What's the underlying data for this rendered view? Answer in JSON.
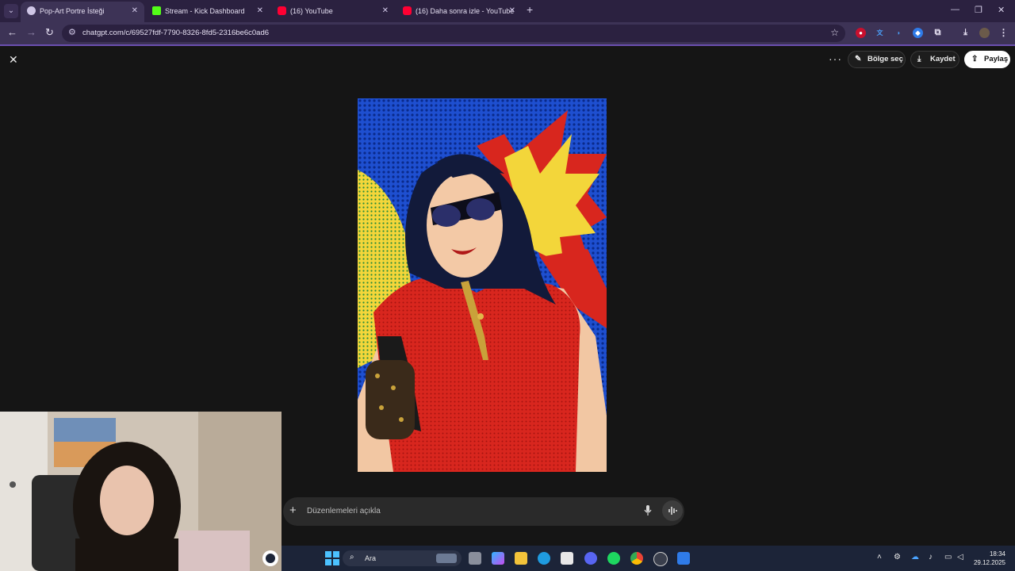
{
  "tabs": [
    {
      "title": "Pop-Art Portre İsteği",
      "active": true,
      "favicon": "chatgpt-icon"
    },
    {
      "title": "Stream - Kick Dashboard",
      "active": false,
      "favicon": "kick-icon"
    },
    {
      "title": "(16) YouTube",
      "active": false,
      "favicon": "youtube-icon"
    },
    {
      "title": "(16) Daha sonra izle - YouTube",
      "active": false,
      "favicon": "youtube-icon"
    }
  ],
  "address_bar": {
    "url": "chatgpt.com/c/69527fdf-7790-8326-8fd5-2316be6c0ad6"
  },
  "viewer": {
    "select_region_label": "Bölge seç",
    "save_label": "Kaydet",
    "share_label": "Paylaş"
  },
  "prompt": {
    "placeholder": "Düzenlemeleri açıkla"
  },
  "taskbar": {
    "search_label": "Ara",
    "time": "18:34",
    "date": "29.12.2025"
  },
  "colors": {
    "tab_strip": "#2b2140",
    "toolbar": "#3d3356",
    "page_bg": "#151515",
    "taskbar": "#1c2438",
    "art_blue": "#1e4fd0",
    "art_red": "#d8261e",
    "art_yellow": "#f3d63a"
  }
}
